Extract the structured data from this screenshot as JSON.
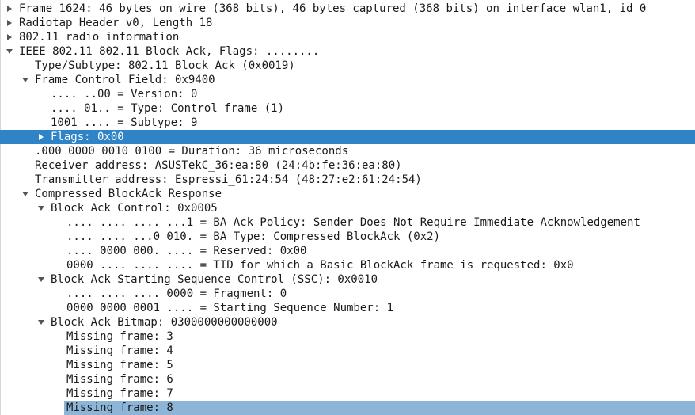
{
  "tree": {
    "rows": [
      {
        "text": "Frame 1624: 46 bytes on wire (368 bits), 46 bytes captured (368 bits) on interface wlan1, id 0",
        "level": 0,
        "toggle": "collapsed"
      },
      {
        "text": "Radiotap Header v0, Length 18",
        "level": 0,
        "toggle": "collapsed"
      },
      {
        "text": "802.11 radio information",
        "level": 0,
        "toggle": "collapsed"
      },
      {
        "text": "IEEE 802.11 802.11 Block Ack, Flags: ........",
        "level": 0,
        "toggle": "expanded"
      },
      {
        "text": "Type/Subtype: 802.11 Block Ack (0x0019)",
        "level": 1,
        "toggle": "none"
      },
      {
        "text": "Frame Control Field: 0x9400",
        "level": 1,
        "toggle": "expanded"
      },
      {
        "text": ".... ..00 = Version: 0",
        "level": 2,
        "toggle": "none"
      },
      {
        "text": ".... 01.. = Type: Control frame (1)",
        "level": 2,
        "toggle": "none"
      },
      {
        "text": "1001 .... = Subtype: 9",
        "level": 2,
        "toggle": "none"
      },
      {
        "text": "Flags: 0x00",
        "level": 2,
        "toggle": "collapsed",
        "selected": "strong"
      },
      {
        "text": ".000 0000 0010 0100 = Duration: 36 microseconds",
        "level": 1,
        "toggle": "none"
      },
      {
        "text": "Receiver address: ASUSTekC_36:ea:80 (24:4b:fe:36:ea:80)",
        "level": 1,
        "toggle": "none"
      },
      {
        "text": "Transmitter address: Espressi_61:24:54 (48:27:e2:61:24:54)",
        "level": 1,
        "toggle": "none"
      },
      {
        "text": "Compressed BlockAck Response",
        "level": 1,
        "toggle": "expanded"
      },
      {
        "text": "Block Ack Control: 0x0005",
        "level": 2,
        "toggle": "expanded"
      },
      {
        "text": ".... .... .... ...1 = BA Ack Policy: Sender Does Not Require Immediate Acknowledgement",
        "level": 3,
        "toggle": "none"
      },
      {
        "text": ".... .... ...0 010. = BA Type: Compressed BlockAck (0x2)",
        "level": 3,
        "toggle": "none"
      },
      {
        "text": ".... 0000 000. .... = Reserved: 0x00",
        "level": 3,
        "toggle": "none"
      },
      {
        "text": "0000 .... .... .... = TID for which a Basic BlockAck frame is requested: 0x0",
        "level": 3,
        "toggle": "none"
      },
      {
        "text": "Block Ack Starting Sequence Control (SSC): 0x0010",
        "level": 2,
        "toggle": "expanded"
      },
      {
        "text": ".... .... .... 0000 = Fragment: 0",
        "level": 3,
        "toggle": "none"
      },
      {
        "text": "0000 0000 0001 .... = Starting Sequence Number: 1",
        "level": 3,
        "toggle": "none"
      },
      {
        "text": "Block Ack Bitmap: 0300000000000000",
        "level": 2,
        "toggle": "expanded"
      },
      {
        "text": "Missing frame: 3",
        "level": 3,
        "toggle": "none"
      },
      {
        "text": "Missing frame: 4",
        "level": 3,
        "toggle": "none"
      },
      {
        "text": "Missing frame: 5",
        "level": 3,
        "toggle": "none"
      },
      {
        "text": "Missing frame: 6",
        "level": 3,
        "toggle": "none"
      },
      {
        "text": "Missing frame: 7",
        "level": 3,
        "toggle": "none"
      },
      {
        "text": "Missing frame: 8",
        "level": 3,
        "toggle": "none",
        "selected": "soft"
      }
    ]
  },
  "colors": {
    "selection_strong": "#2e84c6",
    "selection_soft": "#8db5d7",
    "text": "#1a1a1a"
  },
  "icons": {
    "collapsed": "triangle-right-icon",
    "expanded": "triangle-down-icon"
  }
}
